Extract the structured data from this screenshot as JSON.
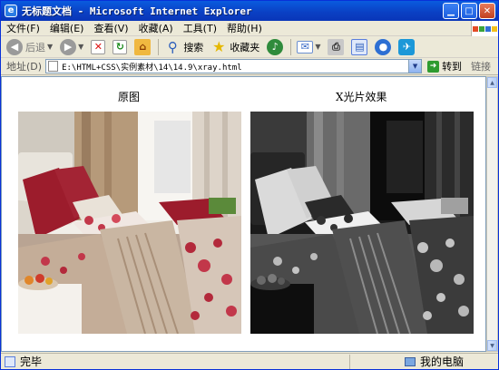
{
  "window": {
    "title": "无标题文档 - Microsoft Internet Explorer",
    "controls": [
      "minimize",
      "maximize",
      "close"
    ]
  },
  "menu": [
    "文件(F)",
    "编辑(E)",
    "查看(V)",
    "收藏(A)",
    "工具(T)",
    "帮助(H)"
  ],
  "toolbar": {
    "back_label": "后退",
    "search_label": "搜索",
    "favorites_label": "收藏夹"
  },
  "address": {
    "label": "地址(D)",
    "value": "E:\\HTML+CSS\\实例素材\\14\\14.9\\xray.html",
    "go_label": "转到",
    "links_label": "链接"
  },
  "content": {
    "original_title": "原图",
    "xray_title": "X光片效果"
  },
  "status": {
    "left_text": "完毕",
    "zone_text": "我的电脑"
  },
  "colors": {
    "titlebar": "#0a4fd6",
    "chrome": "#ece9d8",
    "headboard": "#e8e4dc",
    "pillow_red": "#9c1c2c",
    "bedspread": "#b9a493"
  }
}
